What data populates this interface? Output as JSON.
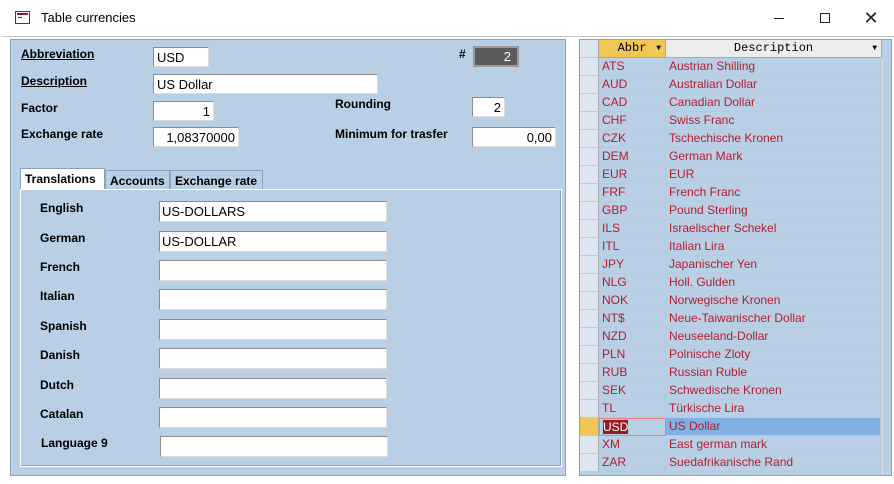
{
  "window": {
    "title": "Table currencies"
  },
  "form": {
    "abbreviation_label": "Abbreviation",
    "abbreviation_value": "USD",
    "description_label": "Description",
    "description_value": "US Dollar",
    "factor_label": "Factor",
    "factor_value": "1",
    "rounding_label": "Rounding",
    "rounding_value": "2",
    "exchange_rate_label": "Exchange rate",
    "exchange_rate_value": "1,08370000",
    "minimum_label": "Minimum for trasfer",
    "minimum_value": "0,00",
    "hash_label": "#",
    "hash_value": "2"
  },
  "tabs": [
    {
      "label": "Translations",
      "active": true
    },
    {
      "label": "Accounts",
      "active": false
    },
    {
      "label": "Exchange rate",
      "active": false
    }
  ],
  "translations": [
    {
      "label": "English",
      "value": "US-DOLLARS"
    },
    {
      "label": "German",
      "value": "US-DOLLAR"
    },
    {
      "label": "French",
      "value": ""
    },
    {
      "label": "Italian",
      "value": ""
    },
    {
      "label": "Spanish",
      "value": ""
    },
    {
      "label": "Danish",
      "value": ""
    },
    {
      "label": "Dutch",
      "value": ""
    },
    {
      "label": "Catalan",
      "value": ""
    },
    {
      "label": "Language 9",
      "value": ""
    }
  ],
  "grid": {
    "columns": [
      "Abbr",
      "Description"
    ],
    "rows": [
      [
        "ATS",
        "Austrian Shilling"
      ],
      [
        "AUD",
        "Australian Dollar"
      ],
      [
        "CAD",
        "Canadian Dollar"
      ],
      [
        "CHF",
        "Swiss Franc"
      ],
      [
        "CZK",
        "Tschechische Kronen"
      ],
      [
        "DEM",
        "German Mark"
      ],
      [
        "EUR",
        "EUR"
      ],
      [
        "FRF",
        "French Franc"
      ],
      [
        "GBP",
        "Pound Sterling"
      ],
      [
        "ILS",
        "Israelischer Schekel"
      ],
      [
        "ITL",
        "Italian Lira"
      ],
      [
        "JPY",
        "Japanischer Yen"
      ],
      [
        "NLG",
        "Holl. Gulden"
      ],
      [
        "NOK",
        "Norwegische Kronen"
      ],
      [
        "NT$",
        "Neue-Taiwanischer Dollar"
      ],
      [
        "NZD",
        "Neuseeland-Dollar"
      ],
      [
        "PLN",
        "Polnische Zloty"
      ],
      [
        "RUB",
        "Russian Ruble"
      ],
      [
        "SEK",
        "Schwedische Kronen"
      ],
      [
        "TL",
        "Türkische Lira"
      ],
      [
        "USD",
        "US Dollar"
      ],
      [
        "XM",
        "East german mark"
      ],
      [
        "ZAR",
        "Suedafrikanische Rand"
      ]
    ],
    "current_row": 20
  },
  "colors": {
    "form_bg": "#b9cfe6",
    "grid_text": "#b21e2e",
    "header_highlight": "#f0c654",
    "selected_row": "#80b0e4"
  }
}
